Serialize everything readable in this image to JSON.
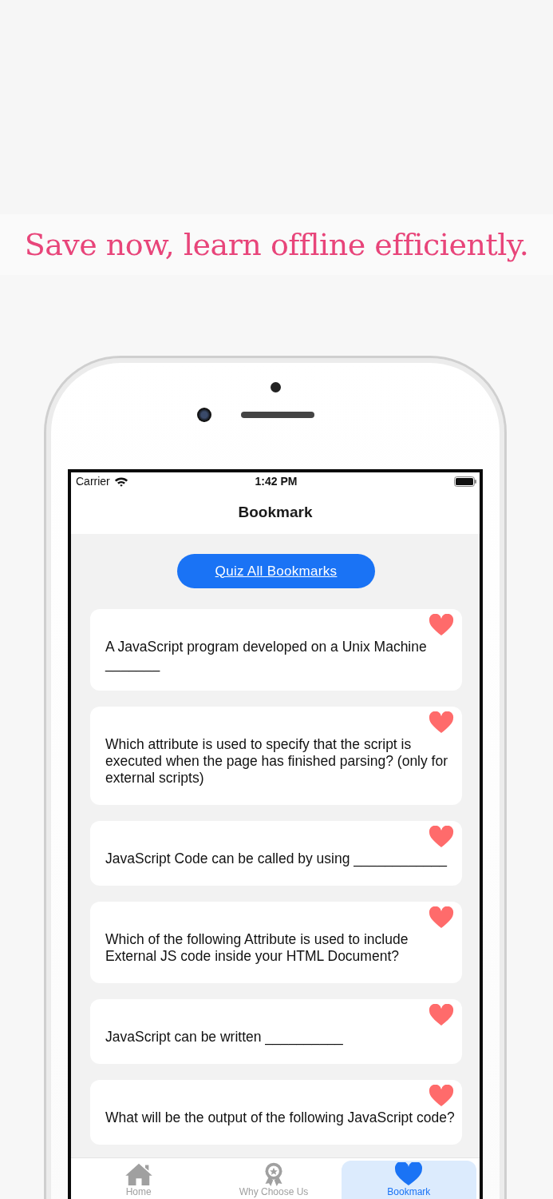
{
  "headline": "Save now, learn offline efficiently.",
  "status_bar": {
    "carrier": "Carrier",
    "time": "1:42 PM"
  },
  "nav": {
    "title": "Bookmark"
  },
  "quiz_button": {
    "label": "Quiz All Bookmarks"
  },
  "questions": [
    {
      "text": "A JavaScript program developed on a Unix Machine\n_______",
      "bookmarked": true
    },
    {
      "text": "Which attribute is used to specify that the script is executed when the page has finished parsing? (only for external scripts)",
      "bookmarked": true
    },
    {
      "text": " JavaScript Code can be called by using ____________",
      "bookmarked": true
    },
    {
      "text": "Which of the following Attribute is used to include External JS code inside your HTML Document?",
      "bookmarked": true
    },
    {
      "text": "JavaScript can be written __________",
      "bookmarked": true
    },
    {
      "text": "What will be the output of the following JavaScript code?",
      "bookmarked": true
    }
  ],
  "tabs": [
    {
      "label": "Home",
      "kind": "home",
      "selected": false
    },
    {
      "label": "Why Choose Us",
      "kind": "award",
      "selected": false
    },
    {
      "label": "Bookmark",
      "kind": "heart",
      "selected": true
    }
  ]
}
